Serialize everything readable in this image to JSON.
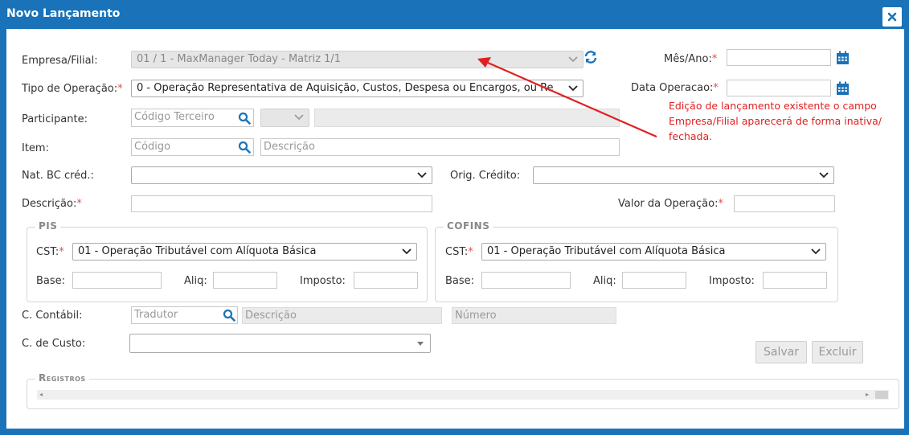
{
  "window": {
    "title": "Novo Lançamento"
  },
  "form": {
    "empresa_label": "Empresa/Filial:",
    "empresa_value": "01 / 1 - MaxManager Today - Matriz 1/1",
    "mes_ano_label": "Mês/Ano:",
    "mes_ano_value": "",
    "tipo_label": "Tipo de Operação:",
    "tipo_value": "0 - Operação Representativa de Aquisição, Custos, Despesa ou Encargos, ou Re",
    "data_op_label": "Data Operacao:",
    "data_op_value": "",
    "participante_label": "Participante:",
    "participante_placeholder": "Código Terceiro",
    "item_label": "Item:",
    "item_code_placeholder": "Código",
    "item_desc_placeholder": "Descrição",
    "nat_bc_label": "Nat. BC créd.:",
    "orig_credito_label": "Orig. Crédito:",
    "descricao_label": "Descrição:",
    "valor_label": "Valor da Operação:",
    "required_mark": "*"
  },
  "pis": {
    "legend": "PIS",
    "cst_label": "CST:",
    "cst_value": "01 - Operação Tributável com Alíquota Básica",
    "base_label": "Base:",
    "aliq_label": "Aliq:",
    "imposto_label": "Imposto:"
  },
  "cofins": {
    "legend": "COFINS",
    "cst_label": "CST:",
    "cst_value": "01 - Operação Tributável com Alíquota Básica",
    "base_label": "Base:",
    "aliq_label": "Aliq:",
    "imposto_label": "Imposto:"
  },
  "contabil": {
    "label": "C. Contábil:",
    "tradutor_placeholder": "Tradutor",
    "descricao_placeholder": "Descrição",
    "numero_placeholder": "Número"
  },
  "custo": {
    "label": "C. de Custo:"
  },
  "buttons": {
    "salvar": "Salvar",
    "excluir": "Excluir"
  },
  "registros": {
    "legend": "Registros"
  },
  "annotation": {
    "line1": "Edição de lançamento existente o campo",
    "line2": "Empresa/Filial aparecerá de forma inativa/",
    "line3": "fechada."
  },
  "colors": {
    "header": "#1a73b8",
    "accent_icon": "#1a73b8",
    "required": "#d9534f",
    "annotation": "#e02020"
  },
  "icons": [
    "close-icon",
    "refresh-icon",
    "calendar-icon",
    "search-icon",
    "chevron-down-icon"
  ]
}
